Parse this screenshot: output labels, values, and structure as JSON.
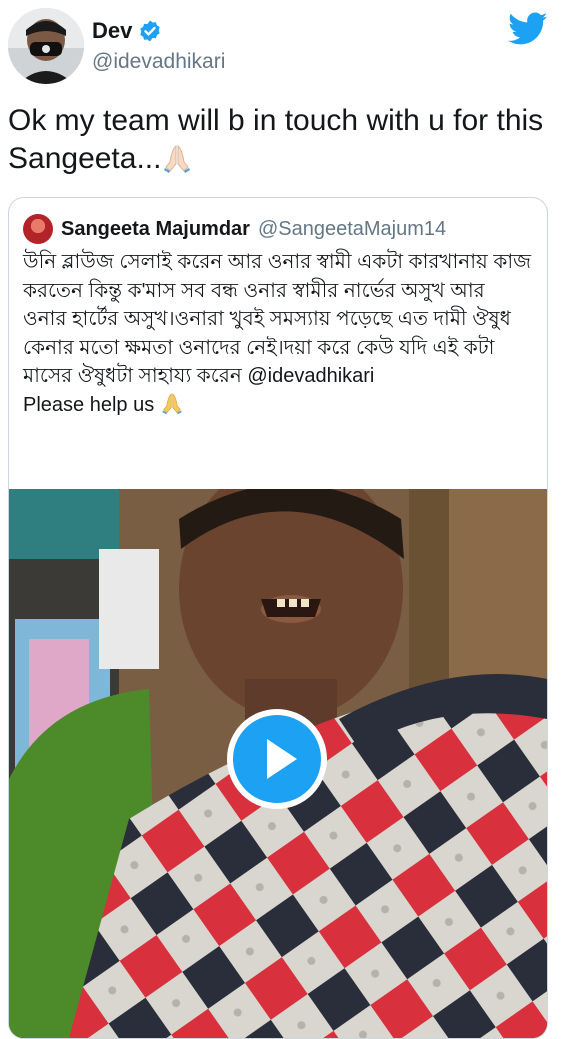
{
  "author": {
    "name": "Dev",
    "handle": "@idevadhikari",
    "verified": true,
    "verified_icon": "verified-badge-icon",
    "avatar_icon": "avatar"
  },
  "brand": {
    "icon": "twitter-bird-icon",
    "color": "#1DA1F2"
  },
  "tweet": {
    "text": "Ok my team will b in touch with u for this Sangeeta...",
    "emoji": "folded-hands-emoji"
  },
  "quoted_tweet": {
    "author_name": "Sangeeta Majumdar",
    "author_handle": "@SangeetaMajum14",
    "body": "উনি ব্লাউজ সেলাই করেন আর ওনার স্বামী একটা কারখানায় কাজ করতেন কিন্তু ক'মাস সব বন্ধ ওনার স্বামীর নার্ভের অসুখ আর ওনার হার্টের অসুখ।ওনারা খুবই সমস্যায় পড়েছে এত দামী ঔষুধ কেনার মতো ক্ষমতা ওনাদের নেই।দয়া করে কেউ যদি এই কটা মাসের ঔষুধটা সাহায্য করেন @idevadhikari",
    "body_line2": "Please help us",
    "emoji": "folded-hands-emoji",
    "media": {
      "type": "video",
      "play_icon": "play-icon",
      "play_color": "#1DA1F2"
    }
  }
}
